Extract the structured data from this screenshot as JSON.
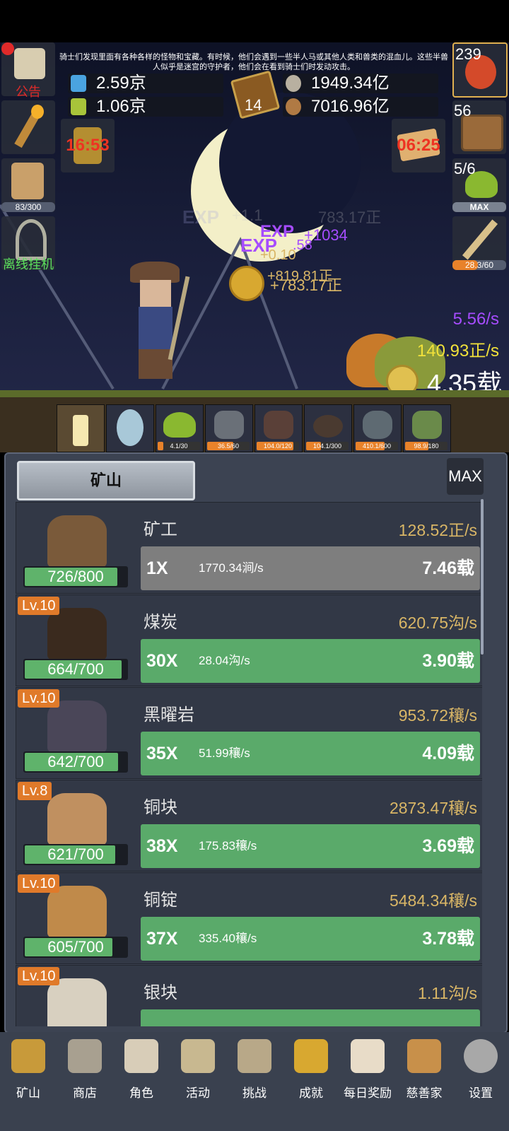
{
  "notice": "骑士们发现里面有各种各样的怪物和宝藏。有时候，他们会遇到一些半人马或其他人类和兽类的混血儿。这些半兽人似乎是迷宫的守护者，他们会在看到骑士们时发动攻击。",
  "resources": {
    "blue_potion": "2.59京",
    "green_potion": "1.06京",
    "book_count": "14",
    "silver": "1949.34亿",
    "bronze": "7016.96亿"
  },
  "left_buttons": {
    "announcement": "公告",
    "beer_progress": "83/300",
    "offline": "离线挂机"
  },
  "timers": {
    "left": "16:53",
    "right": "06:25"
  },
  "right_buttons": {
    "potion_count": "239",
    "chest_count": "56",
    "slime_count": "5/6",
    "slime_max": "MAX",
    "sword_progress": "28.3/60"
  },
  "scene": {
    "exp_rate": "5.56/s",
    "gold_rate": "140.93正/s",
    "coins": "4.35载",
    "float_a": "+819.81正",
    "float_b": "+783.17正",
    "float_c": "+0.10",
    "float_d": "+1034",
    "float_e": ".58",
    "exp_label": "EXP",
    "ghost_a": "+1.1",
    "ghost_b": "783.17正"
  },
  "monsters": [
    {
      "label": "",
      "fill": 0
    },
    {
      "label": "",
      "fill": 0
    },
    {
      "label": "4.1/30",
      "fill": 0.14
    },
    {
      "label": "36.5/60",
      "fill": 0.61
    },
    {
      "label": "104.0/120",
      "fill": 0.87
    },
    {
      "label": "104.1/300",
      "fill": 0.35
    },
    {
      "label": "410.1/600",
      "fill": 0.68
    },
    {
      "label": "98.9/180",
      "fill": 0.55
    }
  ],
  "panel": {
    "tab": "矿山",
    "max": "MAX",
    "rows": [
      {
        "lv": "",
        "prog": "726/800",
        "fill": 0.91,
        "name": "矿工",
        "rate": "128.52正/s",
        "mult": "1X",
        "per": "1770.34涧/s",
        "cost": "7.46载",
        "gray": true
      },
      {
        "lv": "Lv.10",
        "prog": "664/700",
        "fill": 0.95,
        "name": "煤炭",
        "rate": "620.75沟/s",
        "mult": "30X",
        "per": "28.04沟/s",
        "cost": "3.90载",
        "gray": false
      },
      {
        "lv": "Lv.10",
        "prog": "642/700",
        "fill": 0.92,
        "name": "黑曜岩",
        "rate": "953.72穰/s",
        "mult": "35X",
        "per": "51.99穰/s",
        "cost": "4.09载",
        "gray": false
      },
      {
        "lv": "Lv.8",
        "prog": "621/700",
        "fill": 0.89,
        "name": "铜块",
        "rate": "2873.47穰/s",
        "mult": "38X",
        "per": "175.83穰/s",
        "cost": "3.69载",
        "gray": false
      },
      {
        "lv": "Lv.10",
        "prog": "605/700",
        "fill": 0.86,
        "name": "铜锭",
        "rate": "5484.34穰/s",
        "mult": "37X",
        "per": "335.40穰/s",
        "cost": "3.78载",
        "gray": false
      },
      {
        "lv": "Lv.10",
        "prog": "",
        "fill": 0,
        "name": "银块",
        "rate": "1.11沟/s",
        "mult": "",
        "per": "",
        "cost": "",
        "gray": false
      }
    ]
  },
  "nav": [
    "矿山",
    "商店",
    "角色",
    "活动",
    "挑战",
    "成就",
    "每日奖励",
    "慈善家",
    "设置"
  ],
  "colors": {
    "green": "#5aaa6a",
    "gold": "#d9b666",
    "orange": "#e07a2a",
    "purple": "#a64cff",
    "yellow": "#f2e23a"
  }
}
